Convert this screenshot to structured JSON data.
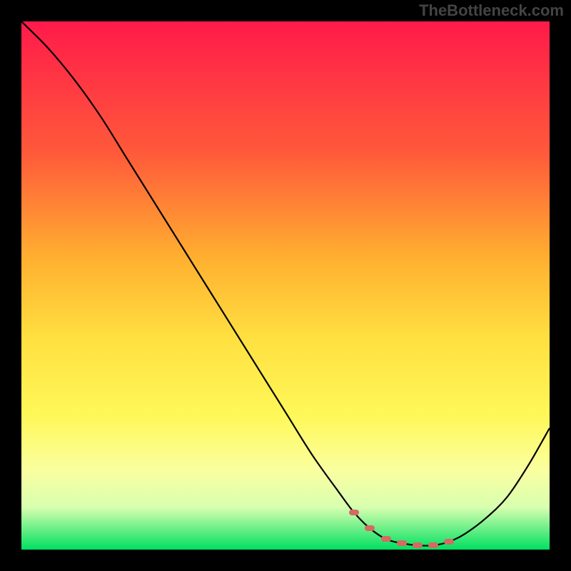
{
  "watermark": "TheBottleneck.com",
  "chart_data": {
    "type": "line",
    "title": "",
    "xlabel": "",
    "ylabel": "",
    "xlim": [
      0,
      100
    ],
    "ylim": [
      0,
      100
    ],
    "series": [
      {
        "name": "bottleneck-curve",
        "x": [
          0,
          5,
          10,
          15,
          20,
          25,
          30,
          35,
          40,
          45,
          50,
          55,
          60,
          63,
          66,
          69,
          72,
          75,
          78,
          81,
          84,
          88,
          92,
          96,
          100
        ],
        "y": [
          100,
          95,
          89,
          82,
          74,
          66,
          58,
          50,
          42,
          34,
          26,
          18,
          11,
          7,
          4,
          2,
          1.2,
          0.8,
          0.8,
          1.5,
          3,
          6,
          10,
          16,
          23
        ]
      }
    ],
    "markers": {
      "name": "optimal-zone",
      "x": [
        63,
        66,
        69,
        72,
        75,
        78,
        81
      ],
      "y": [
        7,
        4,
        2,
        1.2,
        0.8,
        0.8,
        1.5
      ]
    },
    "gradient": {
      "top_color": "#ff1a4a",
      "bottom_color": "#00e060"
    }
  }
}
